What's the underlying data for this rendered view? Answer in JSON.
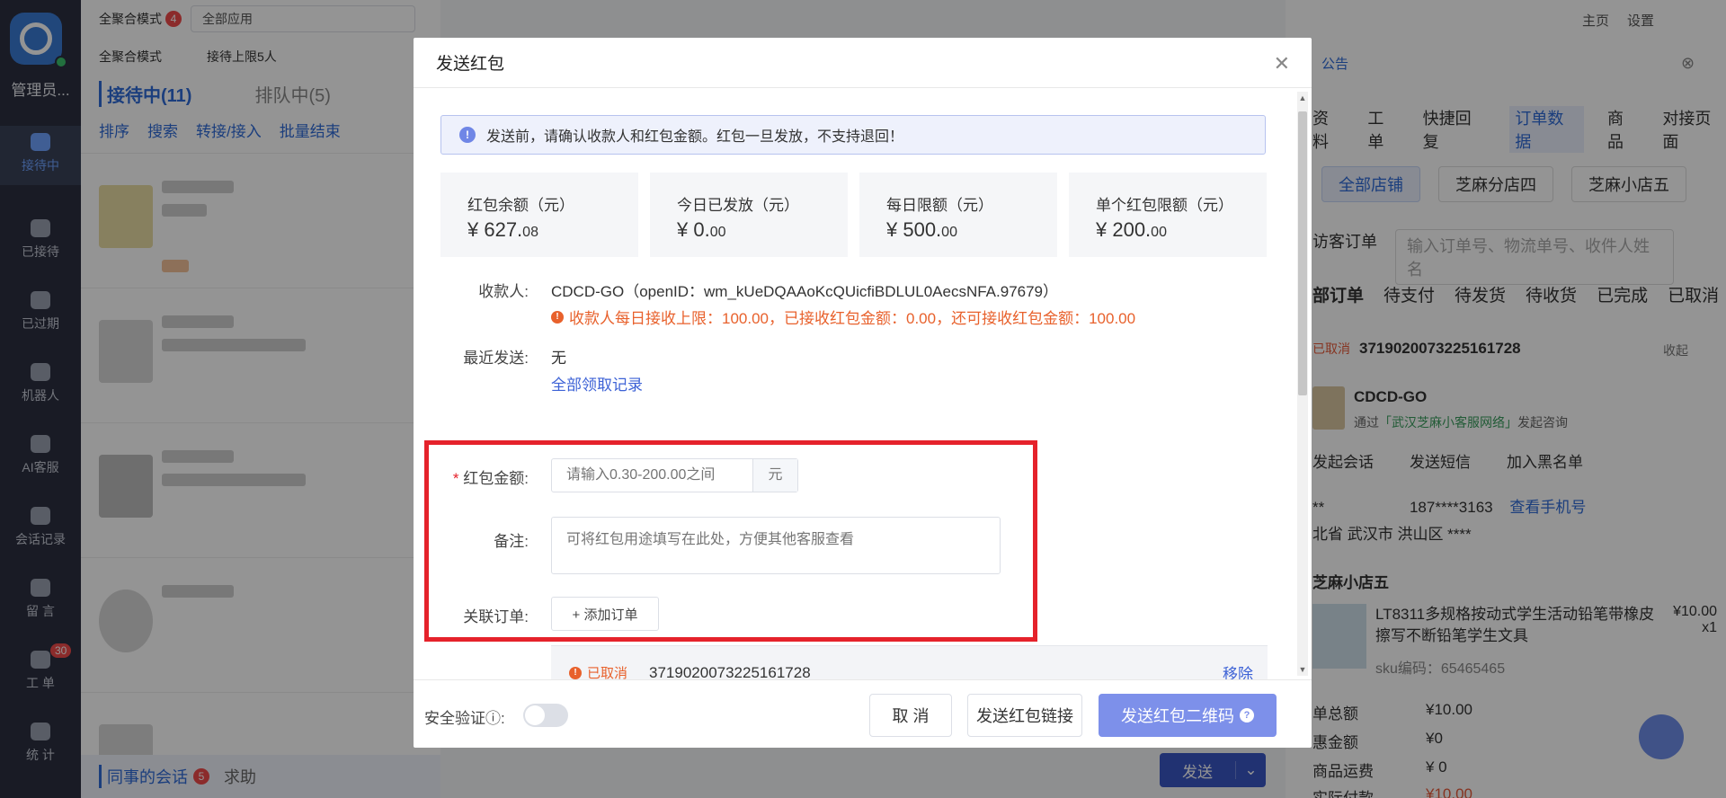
{
  "nav": {
    "admin": "管理员...",
    "items": [
      {
        "label": "接待中",
        "active": true
      },
      {
        "label": "已接待"
      },
      {
        "label": "已过期"
      },
      {
        "label": "机器人"
      },
      {
        "label": "AI客服"
      },
      {
        "label": "会话记录"
      },
      {
        "label": "留 言"
      },
      {
        "label": "工 单",
        "badge": "30"
      },
      {
        "label": "统 计"
      }
    ]
  },
  "sessions": {
    "mode": "全聚合模式",
    "mode_badge": "4",
    "app_select": "全部应用",
    "mode2": "全聚合模式",
    "limit": "接待上限5人",
    "tab_active": "接待中(11)",
    "tab_queue": "排队中(5)",
    "tools": [
      "排序",
      "搜索",
      "转接/接入",
      "批量结束"
    ],
    "bottom_tab": "同事的会话",
    "bottom_badge": "5",
    "bottom_help": "求助"
  },
  "chat": {
    "send_label": "发送"
  },
  "right": {
    "home": "主页",
    "settings": "设置",
    "notice": "公告",
    "tabs": [
      "资料",
      "工单",
      "快捷回复",
      "订单数据",
      "商品",
      "对接页面"
    ],
    "shops": [
      "全部店铺",
      "芝麻分店四",
      "芝麻小店五"
    ],
    "order_type": "访客订单",
    "search_placeholder": "输入订单号、物流单号、收件人姓名",
    "subtabs": [
      "部订单",
      "待支付",
      "待发货",
      "待收货",
      "已完成",
      "已取消"
    ],
    "order_status": "已取消",
    "order_no": "3719020073225161728",
    "collapse": "收起",
    "customer": "CDCD-GO",
    "via_prefix": "通过",
    "via_name": "「武汉芝麻小客服网络」",
    "via_suffix": "发起咨询",
    "actions": [
      "发起会话",
      "发送短信",
      "加入黑名单"
    ],
    "phone_mask": "**",
    "phone": "187****3163",
    "view_phone": "查看手机号",
    "address": "北省 武汉市 洪山区 ****",
    "shop": "芝麻小店五",
    "product_title": "LT8311多规格按动式学生活动铅笔带橡皮擦写不断铅笔学生文具",
    "product_price": "¥10.00",
    "product_qty": "x1",
    "sku": "sku编码：65465465",
    "summary": [
      {
        "label": "单总额",
        "value": "¥10.00"
      },
      {
        "label": "惠金额",
        "value": "¥0"
      },
      {
        "label": "商品运费",
        "value": "¥ 0"
      },
      {
        "label": "实际付款",
        "value": "¥10.00"
      }
    ]
  },
  "modal": {
    "title": "发送红包",
    "alert": "发送前，请确认收款人和红包金额。红包一旦发放，不支持退回！",
    "stats": [
      {
        "label": "红包余额（元）",
        "int": "¥ 627.",
        "dec": "08"
      },
      {
        "label": "今日已发放（元）",
        "int": "¥ 0.",
        "dec": "00"
      },
      {
        "label": "每日限额（元）",
        "int": "¥ 500.",
        "dec": "00"
      },
      {
        "label": "单个红包限额（元）",
        "int": "¥ 200.",
        "dec": "00"
      }
    ],
    "payee_label": "收款人:",
    "payee_value": "CDCD-GO（openID：wm_kUeDQAAoKcQUicfiBDLUL0AecsNFA.97679）",
    "payee_warning": "收款人每日接收上限：100.00，已接收红包金额：0.00，还可接收红包金额：100.00",
    "recent_label": "最近发送:",
    "recent_value": "无",
    "records_link": "全部领取记录",
    "amount_label": "红包金额:",
    "amount_placeholder": "请输入0.30-200.00之间",
    "amount_unit": "元",
    "note_label": "备注:",
    "note_placeholder": "可将红包用途填写在此处，方便其他客服查看",
    "order_label": "关联订单:",
    "add_order": "+ 添加订单",
    "order_status": "已取消",
    "order_no": "3719020073225161728",
    "remove": "移除",
    "security_label": "安全验证ⓘ:",
    "security_on": false,
    "cancel": "取 消",
    "send_link": "发送红包链接",
    "send_qr": "发送红包二维码"
  }
}
